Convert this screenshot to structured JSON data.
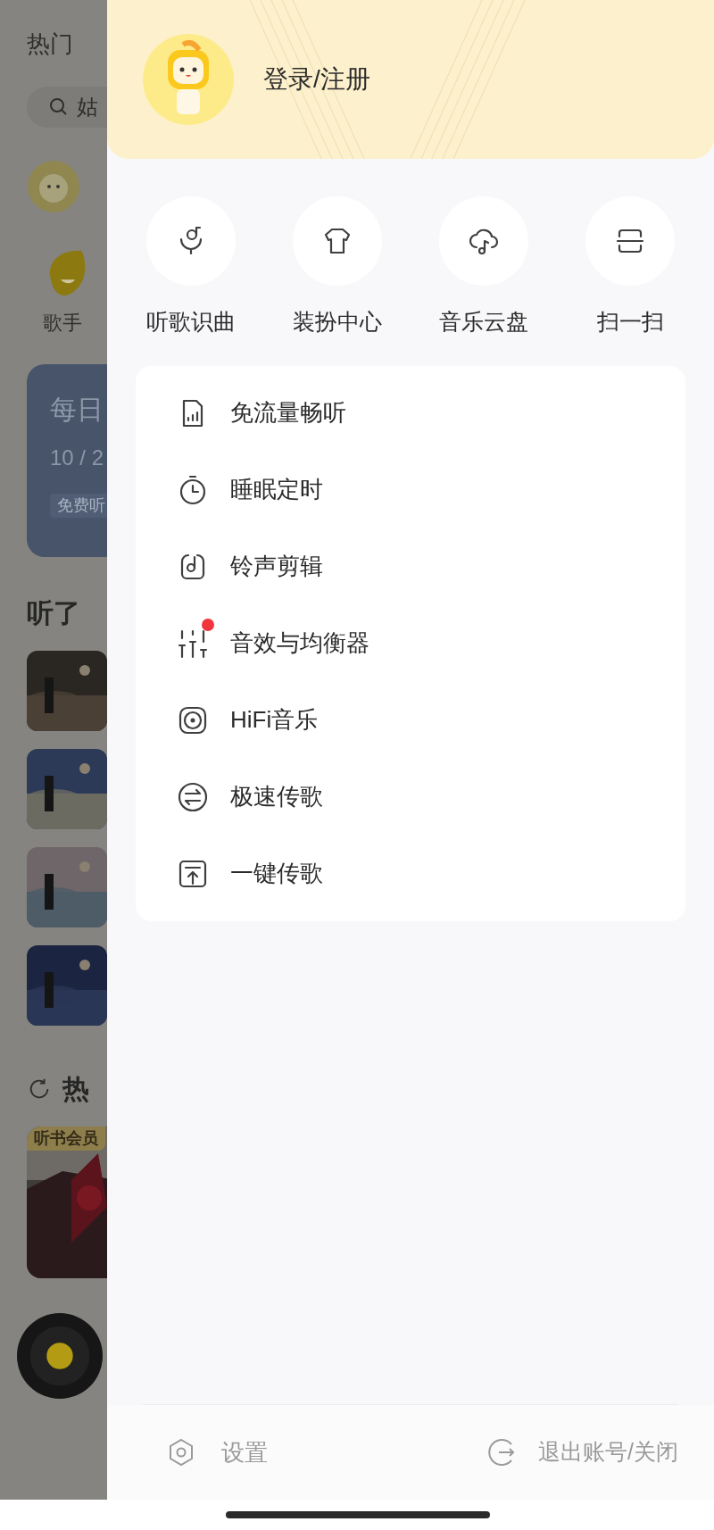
{
  "background_page": {
    "title": "热门",
    "search": {
      "placeholder": "姑"
    },
    "category": {
      "label": "歌手"
    },
    "daily_card": {
      "title": "每日",
      "date": "10 / 2",
      "tag": "免费听"
    },
    "recent": {
      "title": "听了"
    },
    "hot": {
      "title": "热",
      "tag": "听书会员"
    }
  },
  "drawer": {
    "login_label": "登录/注册",
    "shortcuts": [
      {
        "label": "听歌识曲"
      },
      {
        "label": "装扮中心"
      },
      {
        "label": "音乐云盘"
      },
      {
        "label": "扫一扫"
      }
    ],
    "menu": [
      {
        "label": "免流量畅听",
        "new_badge": false
      },
      {
        "label": "睡眠定时",
        "new_badge": false
      },
      {
        "label": "铃声剪辑",
        "new_badge": false
      },
      {
        "label": "音效与均衡器",
        "new_badge": true
      },
      {
        "label": "HiFi音乐",
        "new_badge": false
      },
      {
        "label": "极速传歌",
        "new_badge": false
      },
      {
        "label": "一键传歌",
        "new_badge": false
      }
    ],
    "footer": {
      "settings": "设置",
      "logout": "退出账号/关闭"
    }
  }
}
